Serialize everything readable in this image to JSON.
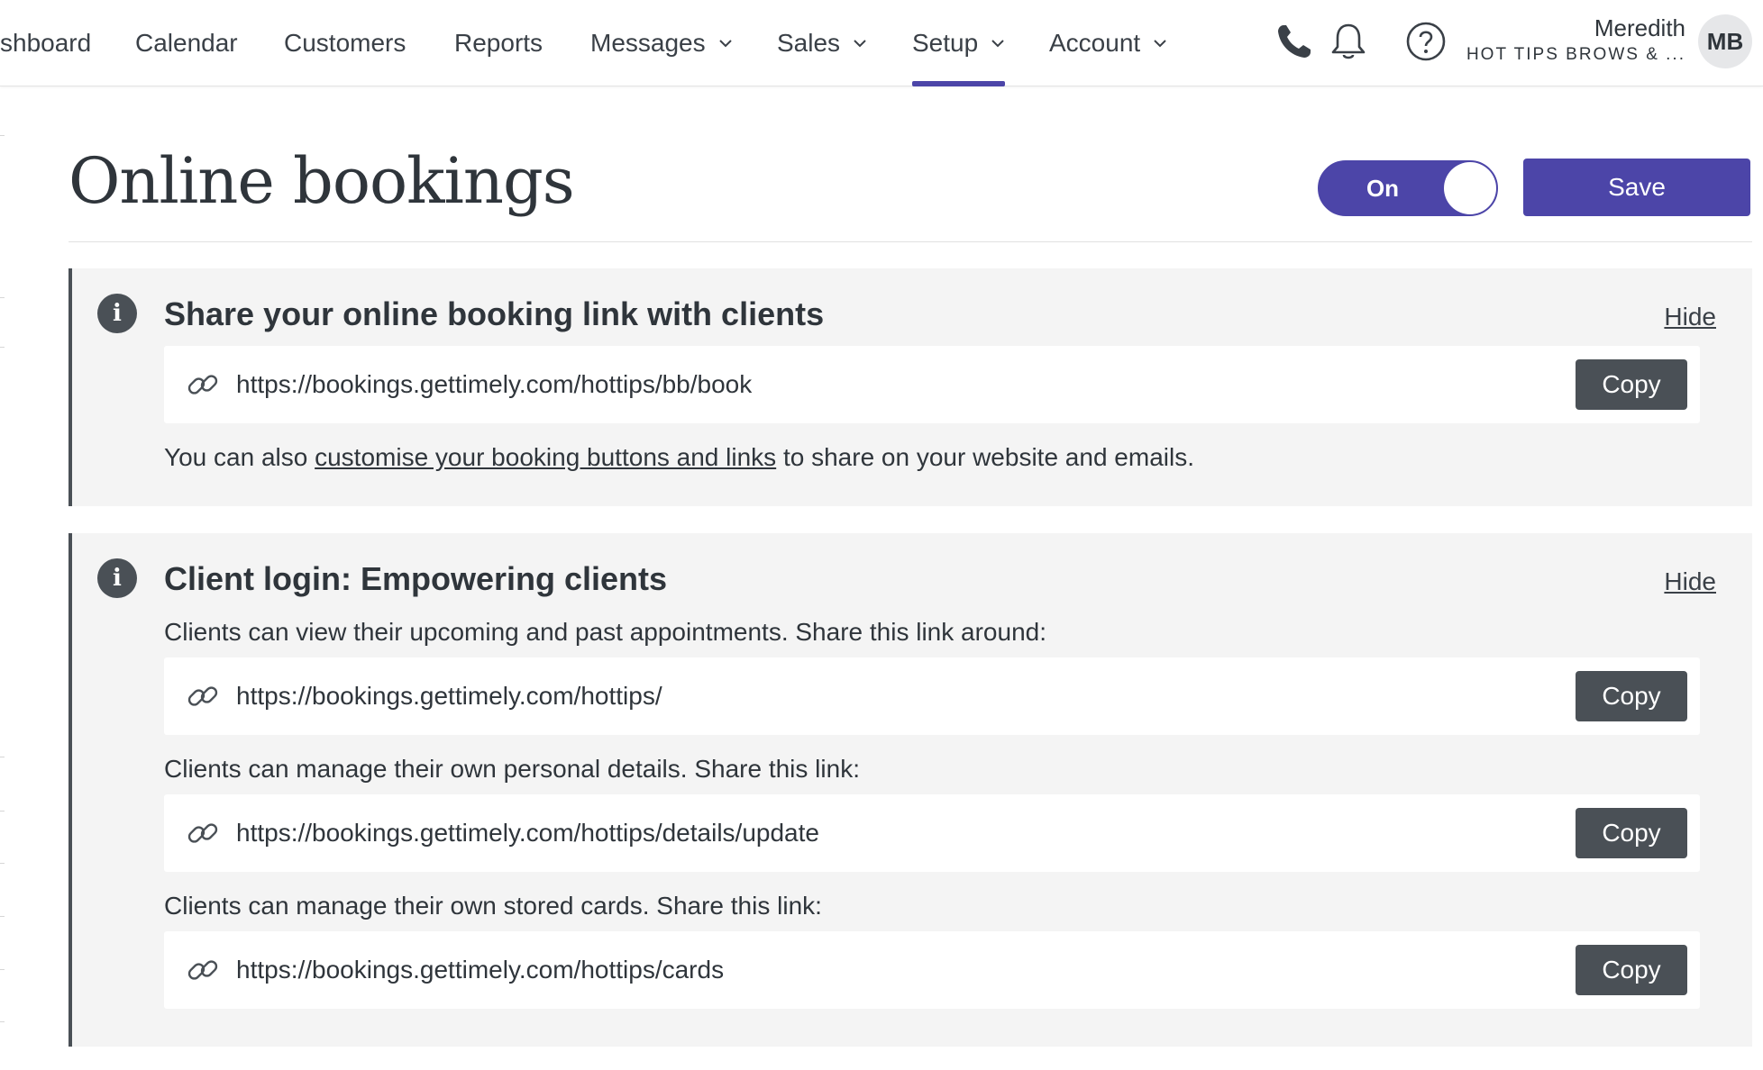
{
  "nav": {
    "items": [
      {
        "label": "shboard",
        "has_dropdown": false,
        "active": false
      },
      {
        "label": "Calendar",
        "has_dropdown": false,
        "active": false
      },
      {
        "label": "Customers",
        "has_dropdown": false,
        "active": false
      },
      {
        "label": "Reports",
        "has_dropdown": false,
        "active": false
      },
      {
        "label": "Messages",
        "has_dropdown": true,
        "active": false
      },
      {
        "label": "Sales",
        "has_dropdown": true,
        "active": false
      },
      {
        "label": "Setup",
        "has_dropdown": true,
        "active": true
      },
      {
        "label": "Account",
        "has_dropdown": true,
        "active": false
      }
    ],
    "icons": [
      "phone-icon",
      "bell-icon",
      "help-icon"
    ],
    "user": {
      "name": "Meredith",
      "org": "HOT TIPS BROWS & ...",
      "initials": "MB"
    }
  },
  "header": {
    "title": "Online bookings",
    "toggle_label": "On",
    "toggle_on": true,
    "save_label": "Save"
  },
  "share_panel": {
    "title": "Share your online booking link with clients",
    "hide_label": "Hide",
    "url": "https://bookings.gettimely.com/hottips/bb/book",
    "copy_label": "Copy",
    "note_prefix": "You can also ",
    "note_link": "customise your booking buttons and links",
    "note_suffix": " to share on your website and emails."
  },
  "client_panel": {
    "title": "Client login: Empowering clients",
    "hide_label": "Hide",
    "links": [
      {
        "description": "Clients can view their upcoming and past appointments. Share this link around:",
        "url": "https://bookings.gettimely.com/hottips/",
        "copy_label": "Copy"
      },
      {
        "description": "Clients can manage their own personal details. Share this link:",
        "url": "https://bookings.gettimely.com/hottips/details/update",
        "copy_label": "Copy"
      },
      {
        "description": "Clients can manage their own stored cards. Share this link:",
        "url": "https://bookings.gettimely.com/hottips/cards",
        "copy_label": "Copy"
      }
    ]
  },
  "colors": {
    "accent": "#4c45a8",
    "copy_button": "#4a5056",
    "panel_bg": "#f4f4f4",
    "text": "#2f353b"
  }
}
